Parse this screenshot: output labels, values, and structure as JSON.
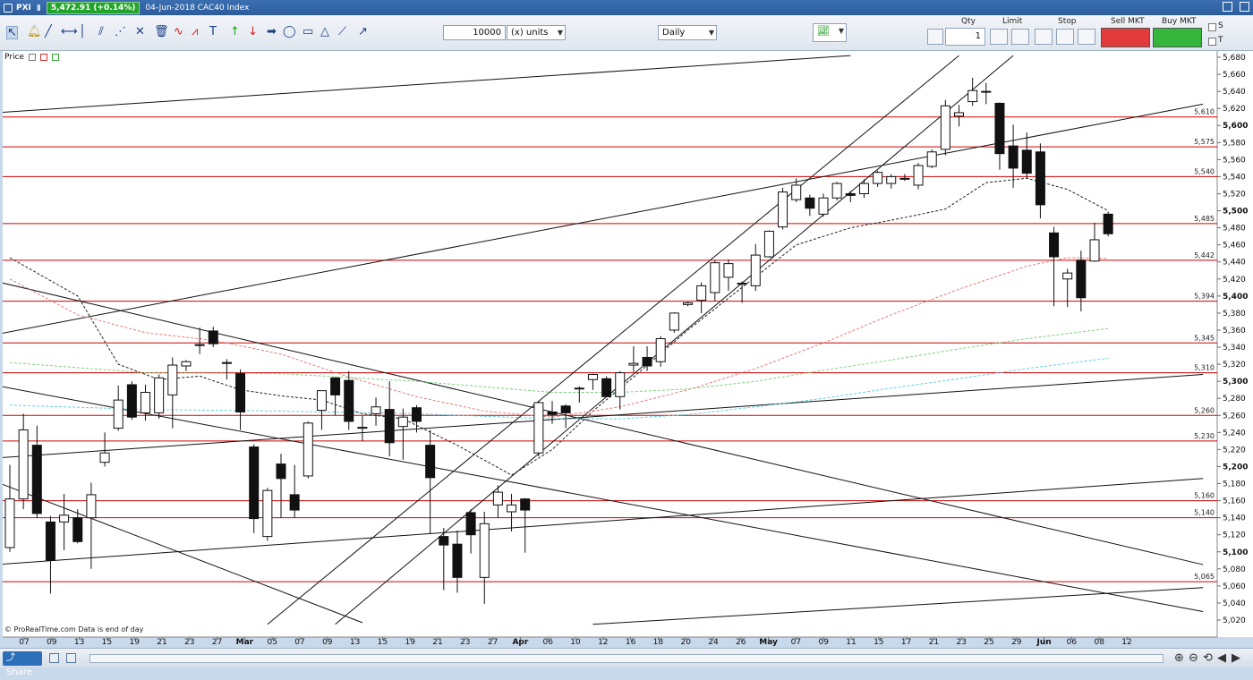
{
  "window": {
    "instrument": "PXI",
    "quote": "5,472.91 (+0.14%)",
    "subtitle": "04-Jun-2018 CAC40 Index"
  },
  "toolbar": {
    "quantity": "10000",
    "units": "(x) units",
    "period": "Daily"
  },
  "order_panel": {
    "qty_label": "Qty",
    "qty_value": "1",
    "limit_label": "Limit",
    "stop_label": "Stop",
    "sell_label": "Sell MKT",
    "buy_label": "Buy MKT",
    "s_label": "S",
    "t_label": "T"
  },
  "price_label": "Price",
  "footer": {
    "credit": "© ProRealTime.com  Data is end of day",
    "share": "Share"
  },
  "colors": {
    "background": "#ffffff",
    "bull": "#ffffff",
    "bear": "#111111",
    "horizontal_level": "#d00000",
    "ma_short": "#222222",
    "ma_mid": "#e87a7a",
    "ma_long": "#7fd17f",
    "ma_longest": "#5fd0e6"
  },
  "chart_data": {
    "type": "candlestick",
    "instrument": "CAC40 Index",
    "date": "04-Jun-2018",
    "ylim": [
      5010,
      5690
    ],
    "y_ticks": [
      5020,
      5040,
      5060,
      5080,
      5100,
      5120,
      5140,
      5160,
      5180,
      5200,
      5220,
      5240,
      5260,
      5280,
      5300,
      5320,
      5340,
      5360,
      5380,
      5400,
      5420,
      5440,
      5460,
      5480,
      5500,
      5520,
      5540,
      5560,
      5580,
      5600,
      5620,
      5640,
      5660,
      5680
    ],
    "y_bold_ticks": [
      5100,
      5200,
      5300,
      5400,
      5500,
      5600
    ],
    "x_labels": [
      "07",
      "09",
      "13",
      "15",
      "19",
      "21",
      "23",
      "27",
      "Mar",
      "05",
      "07",
      "09",
      "13",
      "15",
      "19",
      "21",
      "23",
      "27",
      "Apr",
      "06",
      "10",
      "12",
      "16",
      "18",
      "20",
      "24",
      "26",
      "May",
      "07",
      "09",
      "11",
      "15",
      "17",
      "21",
      "23",
      "25",
      "29",
      "Jun",
      "06",
      "08",
      "12"
    ],
    "x_label_bold": [
      "Mar",
      "Apr",
      "May",
      "Jun"
    ],
    "horizontal_levels": [
      {
        "value": 5610,
        "label": "5,610"
      },
      {
        "value": 5575,
        "label": "5,575"
      },
      {
        "value": 5540,
        "label": "5,540"
      },
      {
        "value": 5485,
        "label": "5,485"
      },
      {
        "value": 5442,
        "label": "5,442"
      },
      {
        "value": 5394,
        "label": "5,394"
      },
      {
        "value": 5345,
        "label": "5,345"
      },
      {
        "value": 5310,
        "label": "5,310"
      },
      {
        "value": 5260,
        "label": "5,260"
      },
      {
        "value": 5230,
        "label": "5,230"
      },
      {
        "value": 5160,
        "label": "5,160"
      },
      {
        "value": 5140,
        "label": "5,140"
      },
      {
        "value": 5065,
        "label": "5,065"
      }
    ],
    "candles": [
      {
        "o": 5105,
        "h": 5202,
        "l": 5100,
        "c": 5162
      },
      {
        "o": 5162,
        "h": 5262,
        "l": 5150,
        "c": 5243
      },
      {
        "o": 5225,
        "h": 5248,
        "l": 5140,
        "c": 5145
      },
      {
        "o": 5135,
        "h": 5142,
        "l": 5051,
        "c": 5090
      },
      {
        "o": 5135,
        "h": 5168,
        "l": 5102,
        "c": 5143
      },
      {
        "o": 5140,
        "h": 5150,
        "l": 5110,
        "c": 5112
      },
      {
        "o": 5140,
        "h": 5181,
        "l": 5080,
        "c": 5167
      },
      {
        "o": 5205,
        "h": 5240,
        "l": 5200,
        "c": 5216
      },
      {
        "o": 5245,
        "h": 5295,
        "l": 5242,
        "c": 5278
      },
      {
        "o": 5296,
        "h": 5300,
        "l": 5255,
        "c": 5258
      },
      {
        "o": 5263,
        "h": 5296,
        "l": 5254,
        "c": 5287
      },
      {
        "o": 5263,
        "h": 5308,
        "l": 5256,
        "c": 5304
      },
      {
        "o": 5284,
        "h": 5328,
        "l": 5245,
        "c": 5319
      },
      {
        "o": 5318,
        "h": 5325,
        "l": 5312,
        "c": 5323
      },
      {
        "o": 5343,
        "h": 5363,
        "l": 5332,
        "c": 5343
      },
      {
        "o": 5359,
        "h": 5364,
        "l": 5340,
        "c": 5344
      },
      {
        "o": 5322,
        "h": 5326,
        "l": 5302,
        "c": 5322
      },
      {
        "o": 5309,
        "h": 5314,
        "l": 5243,
        "c": 5264
      },
      {
        "o": 5223,
        "h": 5226,
        "l": 5122,
        "c": 5139
      },
      {
        "o": 5118,
        "h": 5175,
        "l": 5113,
        "c": 5172
      },
      {
        "o": 5203,
        "h": 5215,
        "l": 5140,
        "c": 5186
      },
      {
        "o": 5167,
        "h": 5202,
        "l": 5140,
        "c": 5149
      },
      {
        "o": 5189,
        "h": 5253,
        "l": 5186,
        "c": 5251
      },
      {
        "o": 5266,
        "h": 5289,
        "l": 5243,
        "c": 5289
      },
      {
        "o": 5304,
        "h": 5305,
        "l": 5260,
        "c": 5284
      },
      {
        "o": 5301,
        "h": 5312,
        "l": 5243,
        "c": 5253
      },
      {
        "o": 5246,
        "h": 5260,
        "l": 5230,
        "c": 5245
      },
      {
        "o": 5262,
        "h": 5281,
        "l": 5248,
        "c": 5270
      },
      {
        "o": 5267,
        "h": 5300,
        "l": 5212,
        "c": 5228
      },
      {
        "o": 5247,
        "h": 5268,
        "l": 5208,
        "c": 5258
      },
      {
        "o": 5269,
        "h": 5272,
        "l": 5240,
        "c": 5253
      },
      {
        "o": 5225,
        "h": 5243,
        "l": 5121,
        "c": 5187
      },
      {
        "o": 5118,
        "h": 5128,
        "l": 5055,
        "c": 5108
      },
      {
        "o": 5109,
        "h": 5125,
        "l": 5052,
        "c": 5070
      },
      {
        "o": 5146,
        "h": 5150,
        "l": 5098,
        "c": 5120
      },
      {
        "o": 5070,
        "h": 5147,
        "l": 5039,
        "c": 5133
      },
      {
        "o": 5155,
        "h": 5178,
        "l": 5140,
        "c": 5170
      },
      {
        "o": 5147,
        "h": 5168,
        "l": 5124,
        "c": 5155
      },
      {
        "o": 5162,
        "h": 5163,
        "l": 5099,
        "c": 5149
      },
      {
        "o": 5216,
        "h": 5277,
        "l": 5212,
        "c": 5275
      },
      {
        "o": 5264,
        "h": 5277,
        "l": 5250,
        "c": 5261
      },
      {
        "o": 5271,
        "h": 5273,
        "l": 5245,
        "c": 5263
      },
      {
        "o": 5291,
        "h": 5294,
        "l": 5275,
        "c": 5292
      },
      {
        "o": 5302,
        "h": 5309,
        "l": 5290,
        "c": 5308
      },
      {
        "o": 5303,
        "h": 5306,
        "l": 5282,
        "c": 5282
      },
      {
        "o": 5282,
        "h": 5312,
        "l": 5267,
        "c": 5310
      },
      {
        "o": 5319,
        "h": 5341,
        "l": 5311,
        "c": 5321
      },
      {
        "o": 5328,
        "h": 5341,
        "l": 5312,
        "c": 5318
      },
      {
        "o": 5323,
        "h": 5353,
        "l": 5317,
        "c": 5350
      },
      {
        "o": 5360,
        "h": 5381,
        "l": 5357,
        "c": 5380
      },
      {
        "o": 5390,
        "h": 5393,
        "l": 5388,
        "c": 5392
      },
      {
        "o": 5395,
        "h": 5416,
        "l": 5380,
        "c": 5412
      },
      {
        "o": 5404,
        "h": 5442,
        "l": 5394,
        "c": 5439
      },
      {
        "o": 5422,
        "h": 5443,
        "l": 5406,
        "c": 5438
      },
      {
        "o": 5415,
        "h": 5417,
        "l": 5392,
        "c": 5415
      },
      {
        "o": 5412,
        "h": 5461,
        "l": 5406,
        "c": 5448
      },
      {
        "o": 5446,
        "h": 5477,
        "l": 5445,
        "c": 5476
      },
      {
        "o": 5481,
        "h": 5527,
        "l": 5478,
        "c": 5522
      },
      {
        "o": 5513,
        "h": 5538,
        "l": 5510,
        "c": 5530
      },
      {
        "o": 5515,
        "h": 5519,
        "l": 5494,
        "c": 5503
      },
      {
        "o": 5496,
        "h": 5520,
        "l": 5493,
        "c": 5515
      },
      {
        "o": 5515,
        "h": 5534,
        "l": 5512,
        "c": 5532
      },
      {
        "o": 5520,
        "h": 5523,
        "l": 5510,
        "c": 5518
      },
      {
        "o": 5520,
        "h": 5537,
        "l": 5515,
        "c": 5532
      },
      {
        "o": 5532,
        "h": 5547,
        "l": 5528,
        "c": 5545
      },
      {
        "o": 5532,
        "h": 5543,
        "l": 5526,
        "c": 5540
      },
      {
        "o": 5538,
        "h": 5543,
        "l": 5535,
        "c": 5537
      },
      {
        "o": 5530,
        "h": 5556,
        "l": 5525,
        "c": 5553
      },
      {
        "o": 5552,
        "h": 5572,
        "l": 5550,
        "c": 5569
      },
      {
        "o": 5572,
        "h": 5630,
        "l": 5565,
        "c": 5623
      },
      {
        "o": 5611,
        "h": 5624,
        "l": 5599,
        "c": 5615
      },
      {
        "o": 5628,
        "h": 5656,
        "l": 5623,
        "c": 5641
      },
      {
        "o": 5640,
        "h": 5650,
        "l": 5625,
        "c": 5639
      },
      {
        "o": 5626,
        "h": 5627,
        "l": 5548,
        "c": 5567
      },
      {
        "o": 5576,
        "h": 5601,
        "l": 5527,
        "c": 5550
      },
      {
        "o": 5571,
        "h": 5592,
        "l": 5538,
        "c": 5544
      },
      {
        "o": 5569,
        "h": 5579,
        "l": 5491,
        "c": 5507
      },
      {
        "o": 5474,
        "h": 5481,
        "l": 5388,
        "c": 5446
      },
      {
        "o": 5420,
        "h": 5432,
        "l": 5387,
        "c": 5427
      },
      {
        "o": 5442,
        "h": 5453,
        "l": 5382,
        "c": 5398
      },
      {
        "o": 5441,
        "h": 5486,
        "l": 5440,
        "c": 5466
      },
      {
        "o": 5496,
        "h": 5499,
        "l": 5470,
        "c": 5473
      }
    ],
    "moving_averages": [
      {
        "style": "black-dashed",
        "values": [
          [
            0,
            5445
          ],
          [
            5,
            5400
          ],
          [
            8,
            5320
          ],
          [
            11,
            5302
          ],
          [
            14,
            5306
          ],
          [
            17,
            5290
          ],
          [
            20,
            5283
          ],
          [
            23,
            5278
          ],
          [
            26,
            5262
          ],
          [
            29,
            5256
          ],
          [
            33,
            5225
          ],
          [
            37,
            5190
          ],
          [
            40,
            5220
          ],
          [
            43,
            5265
          ],
          [
            46,
            5305
          ],
          [
            50,
            5360
          ],
          [
            54,
            5410
          ],
          [
            58,
            5460
          ],
          [
            62,
            5480
          ],
          [
            66,
            5492
          ],
          [
            69,
            5502
          ],
          [
            72,
            5533
          ],
          [
            75,
            5538
          ],
          [
            78,
            5525
          ],
          [
            81,
            5500
          ]
        ]
      },
      {
        "style": "red-dashed",
        "values": [
          [
            0,
            5420
          ],
          [
            5,
            5378
          ],
          [
            10,
            5357
          ],
          [
            15,
            5348
          ],
          [
            20,
            5332
          ],
          [
            25,
            5305
          ],
          [
            30,
            5282
          ],
          [
            35,
            5265
          ],
          [
            40,
            5258
          ],
          [
            45,
            5270
          ],
          [
            50,
            5290
          ],
          [
            55,
            5315
          ],
          [
            60,
            5345
          ],
          [
            65,
            5378
          ],
          [
            70,
            5408
          ],
          [
            75,
            5435
          ],
          [
            78,
            5445
          ],
          [
            81,
            5444
          ]
        ]
      },
      {
        "style": "green-dashed",
        "values": [
          [
            0,
            5322
          ],
          [
            10,
            5310
          ],
          [
            20,
            5309
          ],
          [
            30,
            5300
          ],
          [
            40,
            5287
          ],
          [
            45,
            5287
          ],
          [
            50,
            5291
          ],
          [
            55,
            5300
          ],
          [
            60,
            5313
          ],
          [
            65,
            5325
          ],
          [
            70,
            5338
          ],
          [
            75,
            5350
          ],
          [
            81,
            5362
          ]
        ]
      },
      {
        "style": "cyan-dashed",
        "values": [
          [
            0,
            5272
          ],
          [
            10,
            5267
          ],
          [
            20,
            5265
          ],
          [
            30,
            5262
          ],
          [
            40,
            5256
          ],
          [
            45,
            5256
          ],
          [
            50,
            5261
          ],
          [
            55,
            5270
          ],
          [
            60,
            5280
          ],
          [
            65,
            5292
          ],
          [
            70,
            5303
          ],
          [
            75,
            5315
          ],
          [
            81,
            5327
          ]
        ]
      }
    ],
    "trendlines": [
      {
        "from": [
          -1,
          5615
        ],
        "to": [
          62,
          5682
        ]
      },
      {
        "from": [
          -1,
          5355
        ],
        "to": [
          88,
          5625
        ]
      },
      {
        "from": [
          -1,
          5417
        ],
        "to": [
          88,
          5085
        ]
      },
      {
        "from": [
          -1,
          5295
        ],
        "to": [
          88,
          5030
        ]
      },
      {
        "from": [
          -1,
          5182
        ],
        "to": [
          26,
          5017
        ]
      },
      {
        "from": [
          -1,
          5210
        ],
        "to": [
          88,
          5308
        ]
      },
      {
        "from": [
          -1,
          5085
        ],
        "to": [
          88,
          5186
        ]
      },
      {
        "from": [
          43,
          5015
        ],
        "to": [
          88,
          5058
        ]
      },
      {
        "from": [
          19,
          5015
        ],
        "to": [
          70,
          5682
        ]
      },
      {
        "from": [
          24,
          5015
        ],
        "to": [
          74,
          5682
        ]
      }
    ]
  }
}
